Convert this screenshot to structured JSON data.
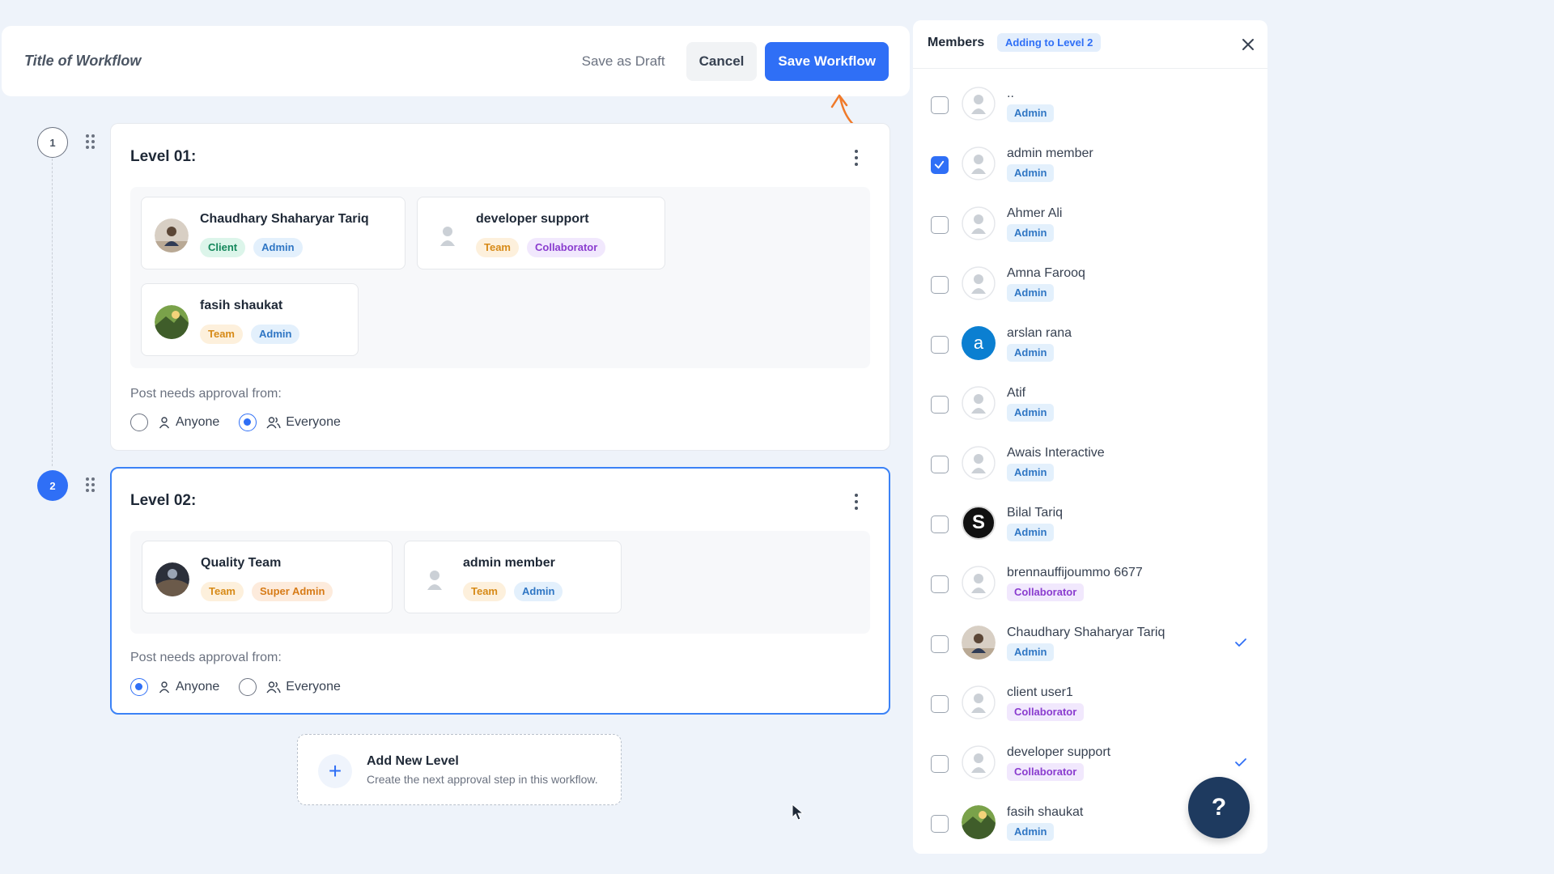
{
  "header": {
    "title": "Title of Workflow",
    "save_draft": "Save as Draft",
    "cancel": "Cancel",
    "save": "Save Workflow"
  },
  "steps": [
    "1",
    "2"
  ],
  "levels": [
    {
      "title": "Level 01:",
      "members": [
        {
          "name": "Chaudhary Shaharyar Tariq",
          "tags": [
            "Client",
            "Admin"
          ]
        },
        {
          "name": "developer support",
          "tags": [
            "Team",
            "Collaborator"
          ]
        },
        {
          "name": "fasih shaukat",
          "tags": [
            "Team",
            "Admin"
          ]
        }
      ],
      "approval_label": "Post needs approval from:",
      "options": [
        "Anyone",
        "Everyone"
      ],
      "selected": "Everyone"
    },
    {
      "title": "Level 02:",
      "members": [
        {
          "name": "Quality Team",
          "tags": [
            "Team",
            "Super Admin"
          ]
        },
        {
          "name": "admin member",
          "tags": [
            "Team",
            "Admin"
          ]
        }
      ],
      "approval_label": "Post needs approval from:",
      "options": [
        "Anyone",
        "Everyone"
      ],
      "selected": "Anyone"
    }
  ],
  "add_level": {
    "title": "Add New Level",
    "subtitle": "Create the next approval step in this workflow."
  },
  "panel": {
    "title": "Members",
    "badge": "Adding to Level 2",
    "members": [
      {
        "name": "..",
        "role": "Admin",
        "checked": false,
        "added": false
      },
      {
        "name": "admin member",
        "role": "Admin",
        "checked": true,
        "added": false
      },
      {
        "name": "Ahmer Ali",
        "role": "Admin",
        "checked": false,
        "added": false
      },
      {
        "name": "Amna Farooq",
        "role": "Admin",
        "checked": false,
        "added": false
      },
      {
        "name": "arslan rana",
        "role": "Admin",
        "checked": false,
        "added": false,
        "initial": "a"
      },
      {
        "name": "Atif",
        "role": "Admin",
        "checked": false,
        "added": false
      },
      {
        "name": "Awais Interactive",
        "role": "Admin",
        "checked": false,
        "added": false
      },
      {
        "name": "Bilal Tariq",
        "role": "Admin",
        "checked": false,
        "added": false,
        "initial": "S"
      },
      {
        "name": "brennauffijoummo 6677",
        "role": "Collaborator",
        "checked": false,
        "added": false
      },
      {
        "name": "Chaudhary Shaharyar Tariq",
        "role": "Admin",
        "checked": false,
        "added": true
      },
      {
        "name": "client user1",
        "role": "Collaborator",
        "checked": false,
        "added": false
      },
      {
        "name": "developer support",
        "role": "Collaborator",
        "checked": false,
        "added": true
      },
      {
        "name": "fasih shaukat",
        "role": "Admin",
        "checked": false,
        "added": false
      }
    ]
  },
  "help": "?",
  "colors": {
    "accent": "#2f6ff6",
    "help": "#1e3a5f",
    "annotation": "#f07a2a"
  }
}
